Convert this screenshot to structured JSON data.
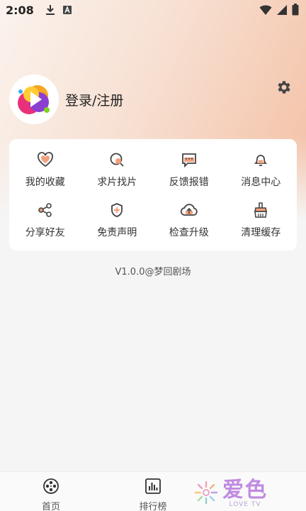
{
  "status_bar": {
    "time": "2:08"
  },
  "profile": {
    "login_label": "登录/注册"
  },
  "menu": {
    "items": [
      {
        "label": "我的收藏",
        "icon": "heart-icon"
      },
      {
        "label": "求片找片",
        "icon": "search-film-icon"
      },
      {
        "label": "反馈报错",
        "icon": "feedback-icon"
      },
      {
        "label": "消息中心",
        "icon": "bell-icon"
      },
      {
        "label": "分享好友",
        "icon": "share-icon"
      },
      {
        "label": "免责声明",
        "icon": "shield-icon"
      },
      {
        "label": "检查升级",
        "icon": "cloud-upload-icon"
      },
      {
        "label": "清理缓存",
        "icon": "broom-icon"
      }
    ]
  },
  "version": "V1.0.0@梦回剧场",
  "bottom_nav": {
    "items": [
      {
        "label": "首页",
        "icon": "film-reel-icon"
      },
      {
        "label": "排行榜",
        "icon": "bar-chart-icon"
      }
    ]
  },
  "watermark": {
    "main": "爱色",
    "sub": "LOVE TV"
  },
  "colors": {
    "accent": "#f4a07a",
    "icon_stroke": "#444444",
    "icon_fill_accent": "#f4a07a",
    "hero_gradient_end": "#f4bfa3"
  }
}
